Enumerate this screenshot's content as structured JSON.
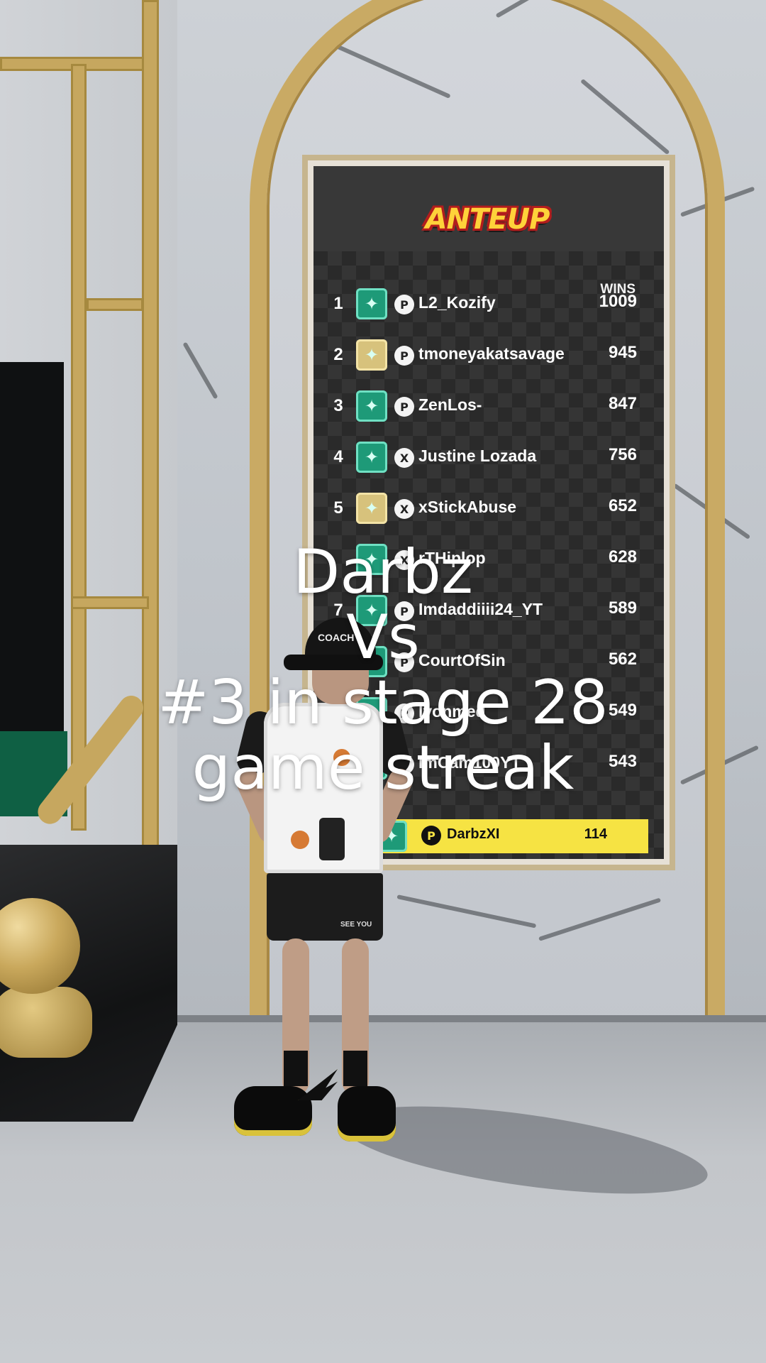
{
  "leaderboard": {
    "logo_text": "ANTEUP",
    "wins_header": "WINS",
    "rows": [
      {
        "rank": "1",
        "name": "L2_Kozify",
        "wins": "1009",
        "badge": "green",
        "platform": "ps"
      },
      {
        "rank": "2",
        "name": "tmoneyakatsavage",
        "wins": "945",
        "badge": "gold",
        "platform": "ps"
      },
      {
        "rank": "3",
        "name": "ZenLos-",
        "wins": "847",
        "badge": "green",
        "platform": "ps"
      },
      {
        "rank": "4",
        "name": "Justine Lozada",
        "wins": "756",
        "badge": "green",
        "platform": "xbox"
      },
      {
        "rank": "5",
        "name": "xStickAbuse",
        "wins": "652",
        "badge": "gold",
        "platform": "xbox"
      },
      {
        "rank": "",
        "name": "rTHiplop",
        "wins": "628",
        "badge": "green",
        "platform": "xbox"
      },
      {
        "rank": "7",
        "name": "Imdaddiiii24_YT",
        "wins": "589",
        "badge": "green",
        "platform": "ps"
      },
      {
        "rank": "",
        "name": "CourtOfSin",
        "wins": "562",
        "badge": "green",
        "platform": "ps"
      },
      {
        "rank": "",
        "name": "lyonmed",
        "wins": "549",
        "badge": "green",
        "platform": "ps"
      },
      {
        "rank": "",
        "name": "ImCam100YT",
        "wins": "543",
        "badge": "green",
        "platform": "ps"
      }
    ],
    "you": {
      "name": "DarbzXI",
      "wins": "114",
      "platform": "ps"
    }
  },
  "player": {
    "cap_text": "COACH",
    "shorts_text": "SEE YOU"
  },
  "caption": {
    "line1": "Darbz",
    "line2": "Vs",
    "line3": "#3 in stage 28",
    "line4": "game streak"
  },
  "colors": {
    "highlight_row": "#f6e343",
    "badge_green": "#1e9a78",
    "badge_gold": "#d7c27c",
    "gold_trim": "#c9aa64"
  }
}
